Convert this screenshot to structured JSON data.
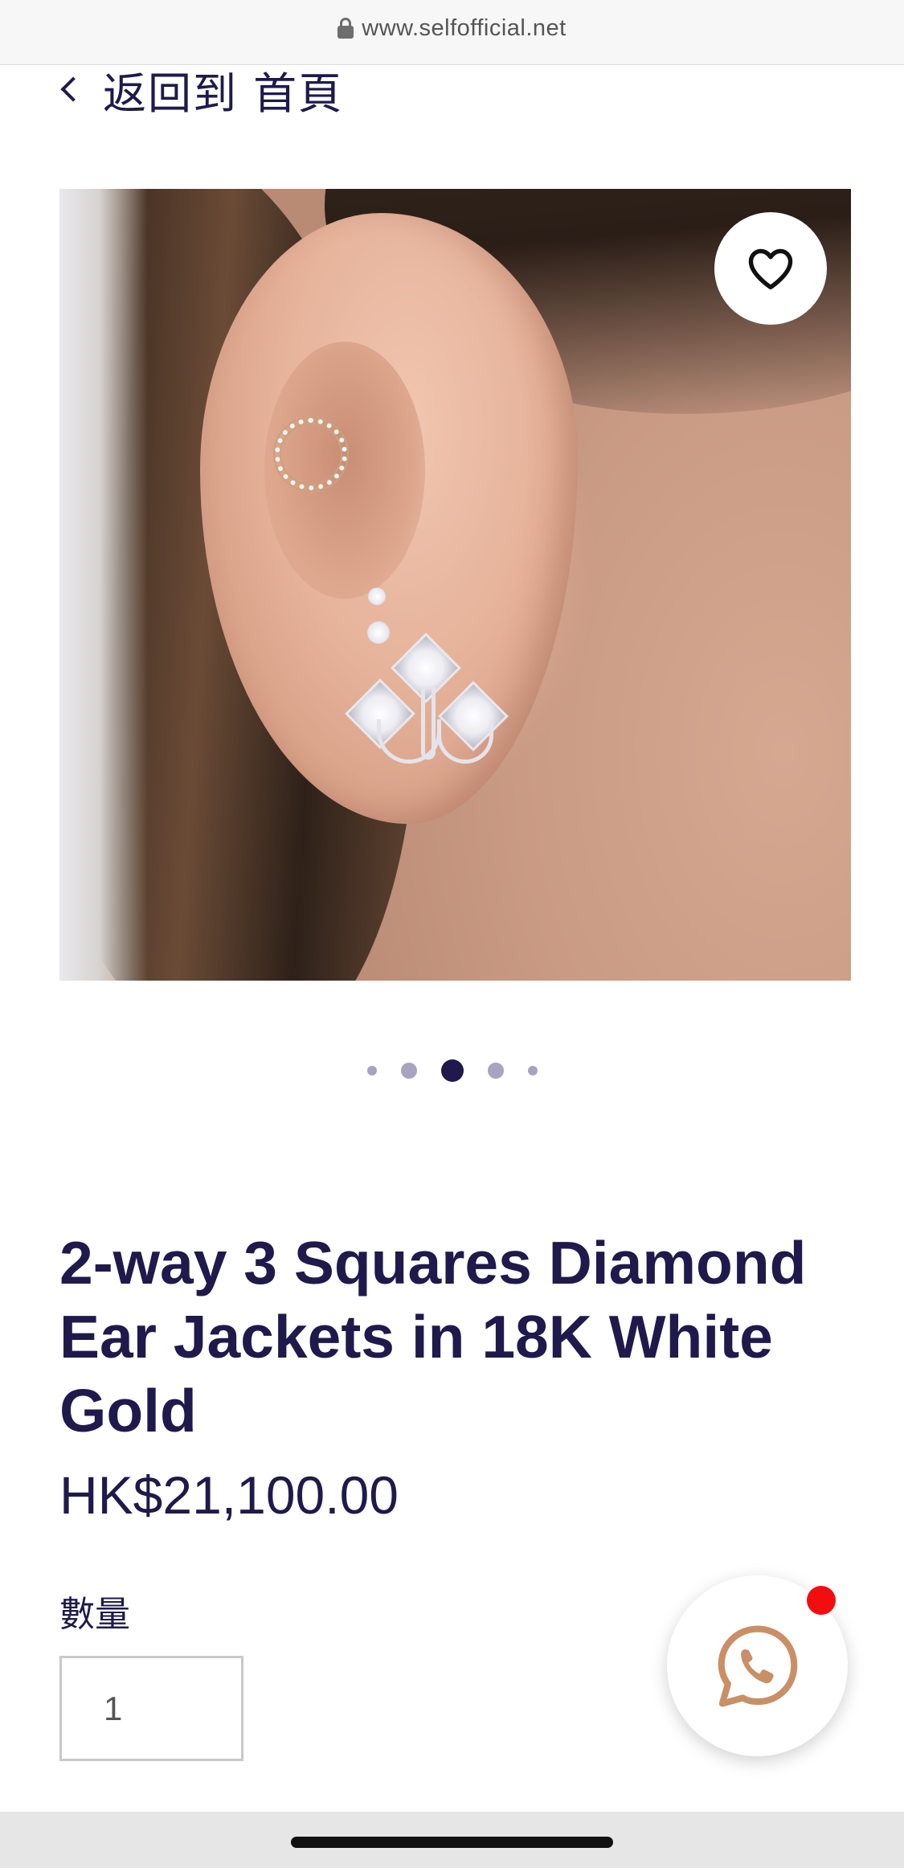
{
  "browser": {
    "url": "www.selfofficial.net",
    "lock_icon": "lock-icon"
  },
  "nav": {
    "back_label": "返回到 首頁",
    "back_icon": "chevron-left-icon"
  },
  "gallery": {
    "image_alt": "Woman's ear wearing diamond ear jackets",
    "favorite_icon": "heart-icon",
    "slide_count": 5,
    "active_slide": 3
  },
  "product": {
    "title": "2-way 3 Squares Diamond Ear Jackets in 18K White Gold",
    "price": "HK$21,100.00",
    "quantity_label": "數量",
    "quantity_value": "1"
  },
  "chat": {
    "icon": "whatsapp-icon",
    "badge_color": "#f20e0e"
  },
  "colors": {
    "primary": "#1f1a4b",
    "dot_inactive": "#a7a3c0",
    "whatsapp_accent": "#c98f66"
  }
}
